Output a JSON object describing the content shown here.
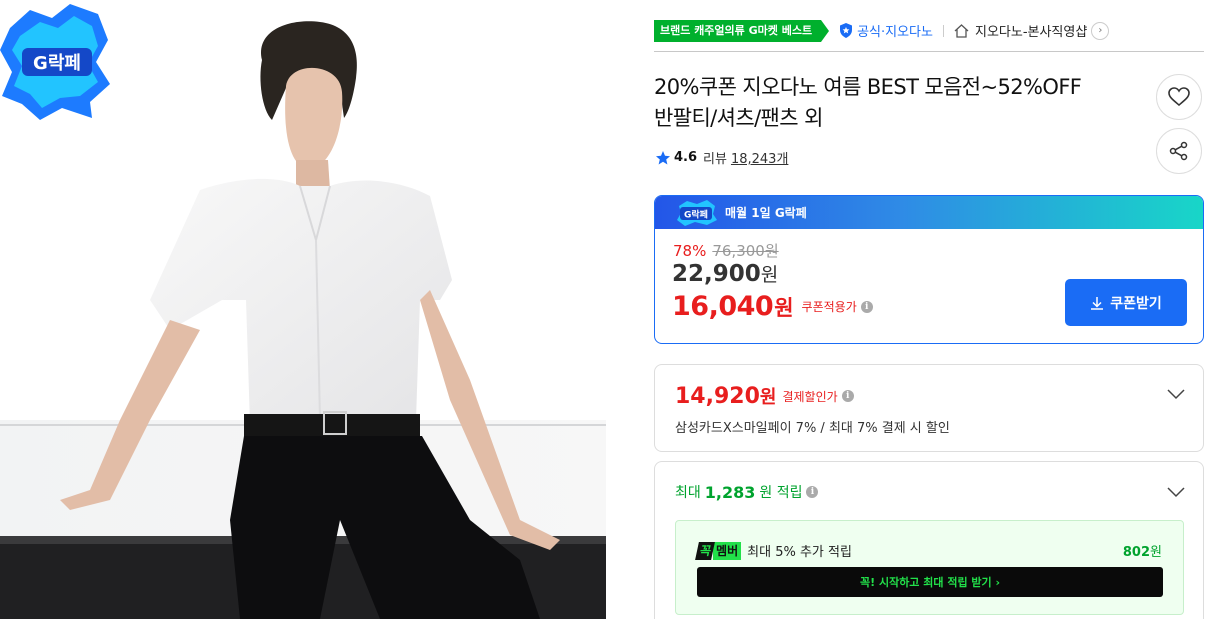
{
  "product_image": {
    "badge_text": "G락페"
  },
  "breadcrumb": {
    "best_badge": "브랜드 캐주얼의류 G마켓 베스트",
    "official_label": "공식·지오다노",
    "shop_name": "지오다노-본사직영샵"
  },
  "product": {
    "title_line1": "20%쿠폰 지오다노 여름 BEST 모음전~52%OFF",
    "title_line2": "반팔티/셔츠/팬츠 외",
    "rating": "4.6",
    "review_label": "리뷰",
    "review_count": "18,243개"
  },
  "price_box": {
    "header_logo": "G락페",
    "header_text": "매월 1일 G락페",
    "discount_rate": "78%",
    "original_price": "76,300원",
    "sale_price": "22,900",
    "sale_currency": "원",
    "coupon_price": "16,040",
    "coupon_currency": "원",
    "coupon_label": "쿠폰적용가",
    "coupon_button": "쿠폰받기"
  },
  "payment": {
    "price": "14,920",
    "currency": "원",
    "label": "결제할인가",
    "description": "삼성카드X스마일페이 7% / 최대 7% 결제 시 할인"
  },
  "points": {
    "prefix": "최대",
    "amount": "1,283",
    "suffix": "원 적립",
    "member_tag_1": "꼭",
    "member_tag_2": "멤버",
    "member_text": "최대 5% 추가 적립",
    "member_amount": "802",
    "member_currency": "원",
    "member_cta": "꼭! 시작하고 최대 적립 받기 ›"
  },
  "colors": {
    "accent_blue": "#1a6cf5",
    "price_red": "#e81e1e",
    "point_green": "#00a32e",
    "best_green": "#00b02d"
  }
}
